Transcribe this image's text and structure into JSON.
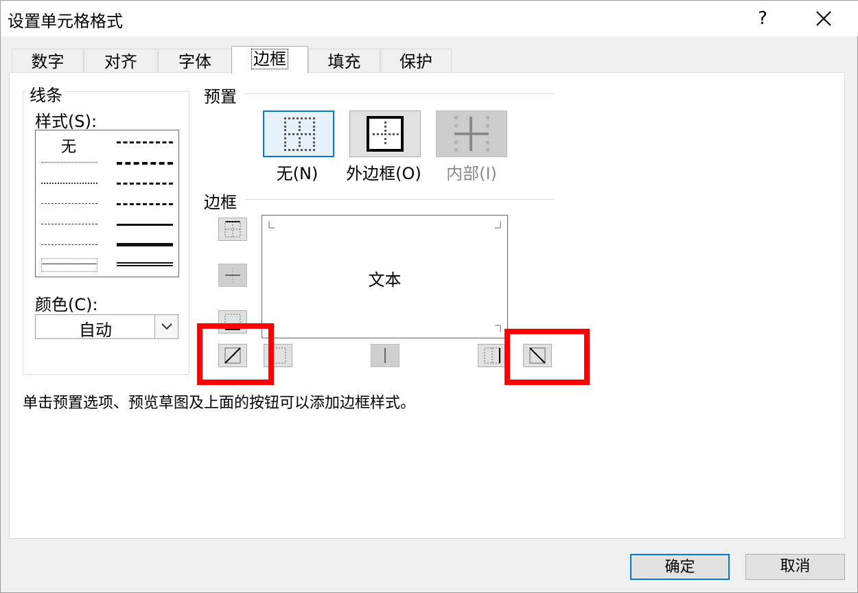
{
  "window": {
    "title": "设置单元格格式",
    "help_label": "?",
    "close_icon": "close-icon"
  },
  "tabs": [
    {
      "label": "数字"
    },
    {
      "label": "对齐"
    },
    {
      "label": "字体"
    },
    {
      "label": "边框",
      "active": true
    },
    {
      "label": "填充"
    },
    {
      "label": "保护"
    }
  ],
  "line_group": {
    "title": "线条",
    "style_label": "样式(S):",
    "none_label": "无",
    "color_label": "颜色(C):",
    "color_value": "自动"
  },
  "presets": {
    "title": "预置",
    "none_label": "无(N)",
    "outline_label": "外边框(O)",
    "inside_label": "内部(I)"
  },
  "border": {
    "title": "边框",
    "preview_text": "文本"
  },
  "hint": "单击预置选项、预览草图及上面的按钮可以添加边框样式。",
  "buttons": {
    "ok": "确定",
    "cancel": "取消"
  },
  "colors": {
    "accent": "#0078d7",
    "highlight": "#ff0000",
    "panel_bg": "#ffffff",
    "dialog_bg": "#f0f0f0"
  }
}
